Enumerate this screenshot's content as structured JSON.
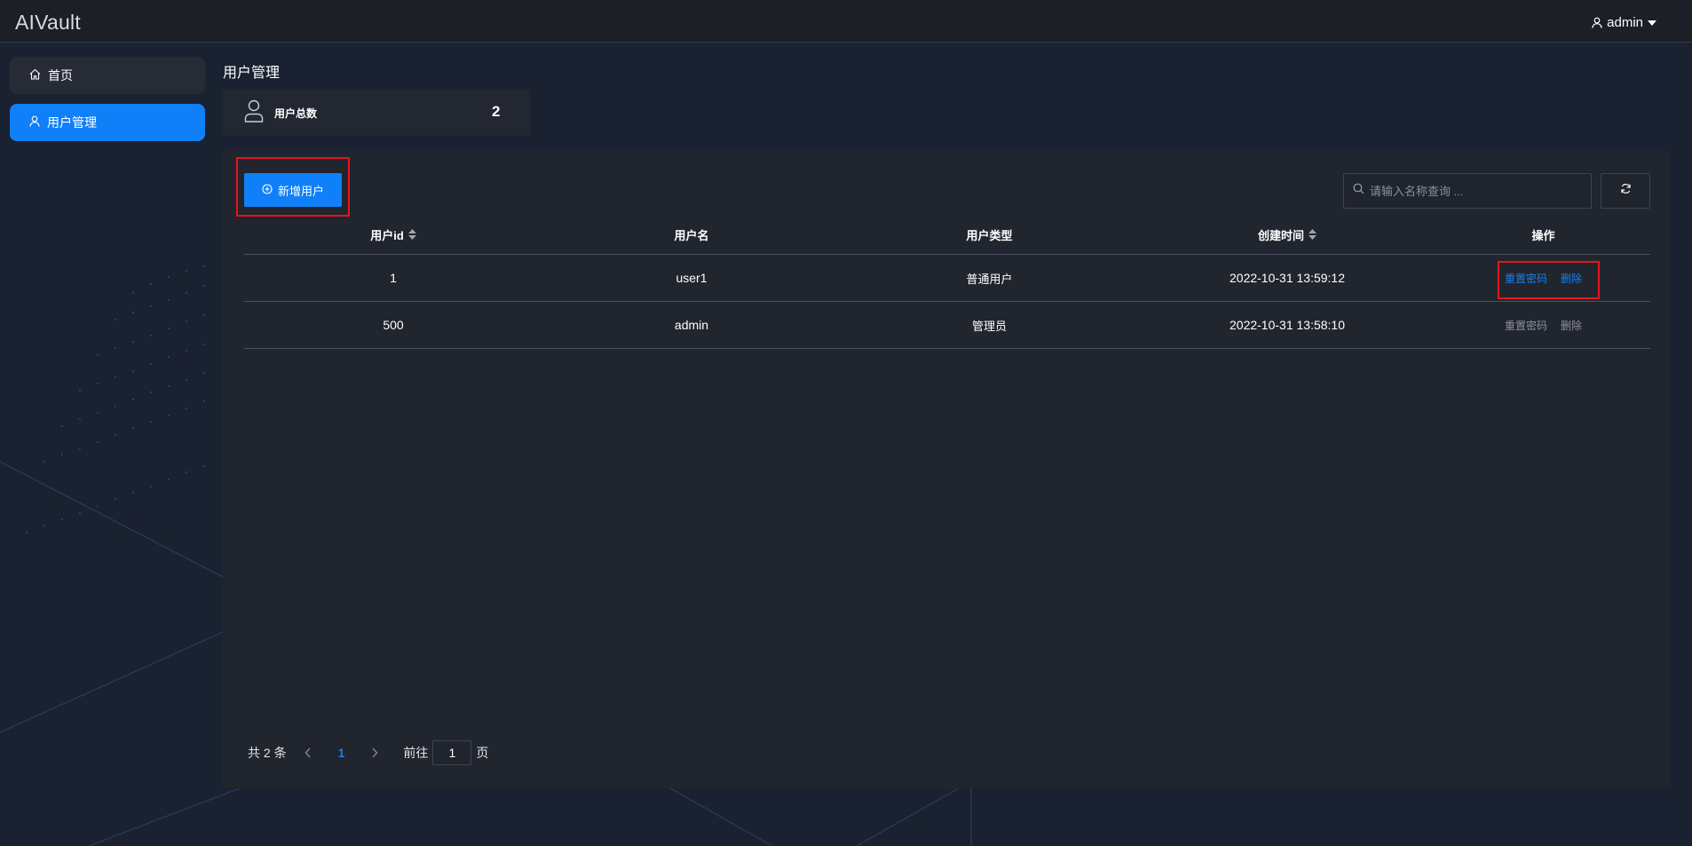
{
  "app": {
    "title": "AIVault"
  },
  "header": {
    "user_name": "admin"
  },
  "sidebar": {
    "items": [
      {
        "label": "首页",
        "active": false,
        "icon": "home-icon"
      },
      {
        "label": "用户管理",
        "active": true,
        "icon": "user-icon"
      }
    ]
  },
  "page": {
    "title": "用户管理"
  },
  "stats": {
    "total_label": "用户总数",
    "total_value": "2"
  },
  "toolbar": {
    "add_label": "新增用户",
    "search_placeholder": "请输入名称查询 ..."
  },
  "table": {
    "headers": [
      "用户id",
      "用户名",
      "用户类型",
      "创建时间",
      "操作"
    ],
    "rows": [
      {
        "id": "1",
        "name": "user1",
        "type": "普通用户",
        "created": "2022-10-31 13:59:12",
        "reset_label": "重置密码",
        "delete_label": "删除",
        "enabled": true
      },
      {
        "id": "500",
        "name": "admin",
        "type": "管理员",
        "created": "2022-10-31 13:58:10",
        "reset_label": "重置密码",
        "delete_label": "删除",
        "enabled": false
      }
    ]
  },
  "pagination": {
    "total_text": "共 2 条",
    "current_page": "1",
    "goto_prefix": "前往",
    "goto_value": "1",
    "goto_suffix": "页"
  },
  "colors": {
    "accent": "#1080f8",
    "link_active": "#1a7ef0",
    "link_disabled": "#8e939c",
    "highlight": "#e8141c"
  }
}
